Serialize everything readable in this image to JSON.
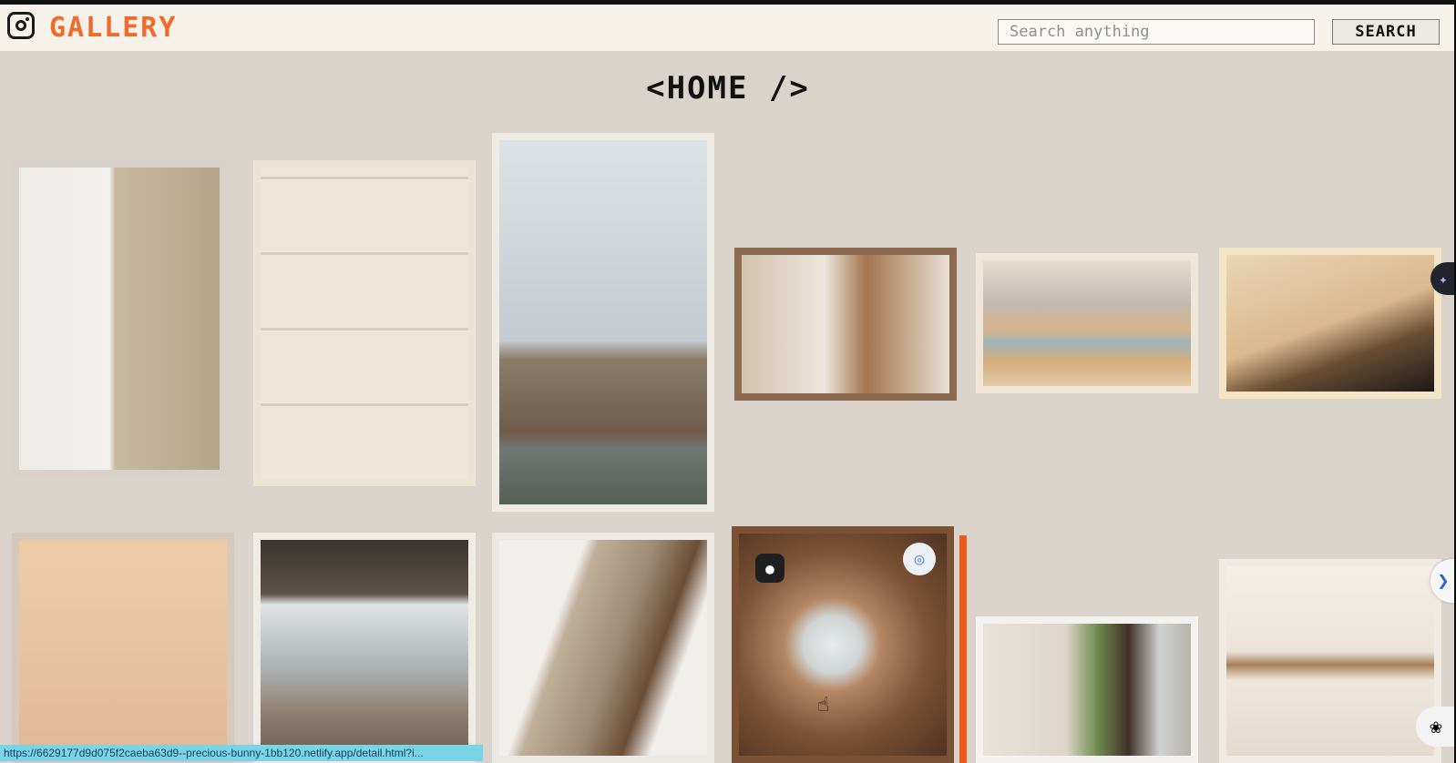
{
  "header": {
    "brand": "GALLERY",
    "logo_icon": "instagram-icon",
    "search_placeholder": "Search anything",
    "search_button": "SEARCH"
  },
  "page": {
    "title": "<HOME />"
  },
  "gallery": {
    "items": [
      {
        "subject": "interior-wall-sconce-painting"
      },
      {
        "subject": "hand-holding-hairdryer"
      },
      {
        "subject": "rock-arch-sea"
      },
      {
        "subject": "wooden-staircase-dining"
      },
      {
        "subject": "mountain-lake-painting"
      },
      {
        "subject": "abstract-shadow-silhouette"
      },
      {
        "subject": "peach-gradient"
      },
      {
        "subject": "city-skyline-veranda"
      },
      {
        "subject": "driftwood-closeup"
      },
      {
        "subject": "airplane-window"
      },
      {
        "subject": "plant-window-interior"
      },
      {
        "subject": "shelf-plants-sunlight"
      }
    ],
    "hover_card_icons": [
      "pin-icon",
      "scan-icon"
    ]
  },
  "floating": {
    "sparkle_icon": "sparkle-icon",
    "next_icon": "chevron-right-icon",
    "brain_icon": "brain-icon"
  },
  "status_bar": {
    "url": "https://6629177d9d075f2caeba63d9--precious-bunny-1bb120.netlify.app/detail.html?i..."
  },
  "colors": {
    "background": "#d9d3cb",
    "brand_orange": "#f06a2a",
    "status_bar": "#79d4e6"
  }
}
